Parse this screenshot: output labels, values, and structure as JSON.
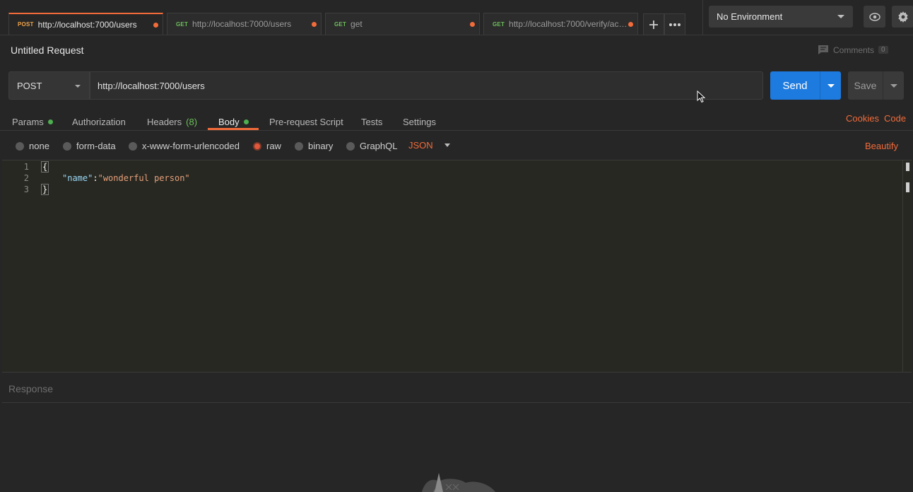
{
  "tabs": [
    {
      "method": "POST",
      "url": "http://localhost:7000/users",
      "active": true
    },
    {
      "method": "GET",
      "url": "http://localhost:7000/users",
      "active": false
    },
    {
      "method": "GET",
      "url": "get",
      "active": false
    },
    {
      "method": "GET",
      "url": "http://localhost:7000/verify/acc...",
      "active": false
    }
  ],
  "environment": {
    "selected": "No Environment"
  },
  "request": {
    "name": "Untitled Request",
    "comments_label": "Comments",
    "comments_count": "0",
    "method": "POST",
    "url": "http://localhost:7000/users",
    "send_label": "Send",
    "save_label": "Save"
  },
  "request_tabs": [
    {
      "label": "Params",
      "dot": true
    },
    {
      "label": "Authorization"
    },
    {
      "label": "Headers",
      "count": "(8)"
    },
    {
      "label": "Body",
      "dot": true,
      "active": true
    },
    {
      "label": "Pre-request Script"
    },
    {
      "label": "Tests"
    },
    {
      "label": "Settings"
    }
  ],
  "right_links": {
    "cookies": "Cookies",
    "code": "Code"
  },
  "body_types": [
    {
      "label": "none",
      "checked": false
    },
    {
      "label": "form-data",
      "checked": false
    },
    {
      "label": "x-www-form-urlencoded",
      "checked": false
    },
    {
      "label": "raw",
      "checked": true
    },
    {
      "label": "binary",
      "checked": false
    },
    {
      "label": "GraphQL",
      "checked": false
    }
  ],
  "language": "JSON",
  "beautify_label": "Beautify",
  "editor": {
    "line_numbers": [
      "1",
      "2",
      "3"
    ],
    "open_brace": "{",
    "key": "\"name\"",
    "colon": ":",
    "value": "\"wonderful person\"",
    "close_brace": "}"
  },
  "response": {
    "label": "Response"
  },
  "colors": {
    "accent": "#f26b3a",
    "send": "#1d7be0",
    "ok": "#4caf50"
  }
}
